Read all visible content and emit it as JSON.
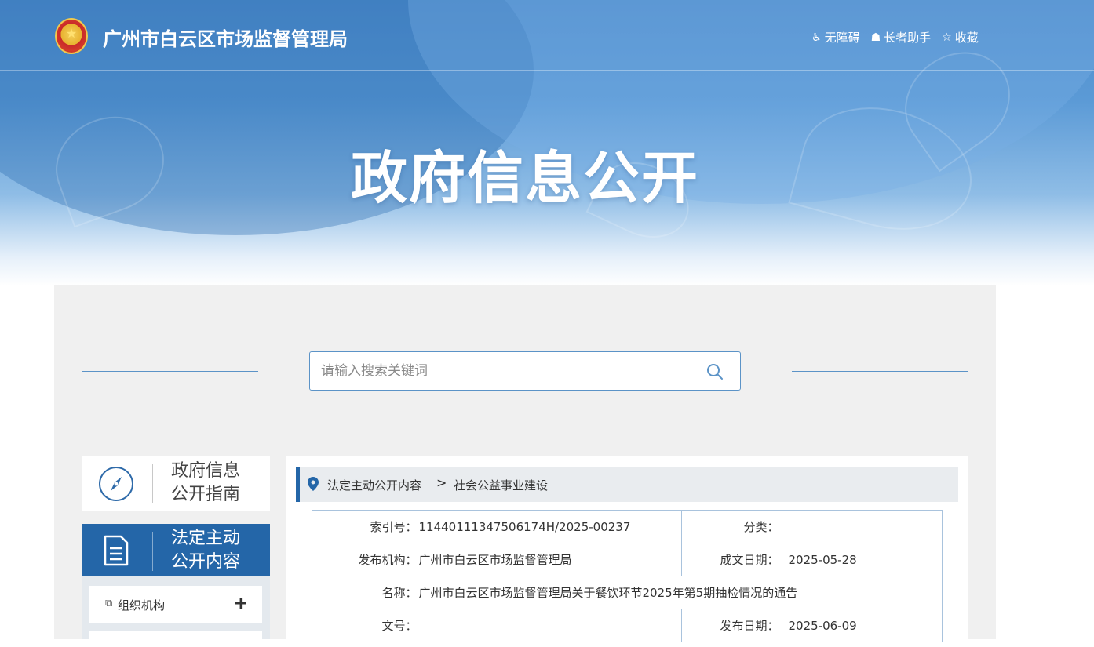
{
  "header": {
    "site_title": "广州市白云区市场监督管理局",
    "links": [
      {
        "label": "无障碍",
        "icon": "accessibility-icon"
      },
      {
        "label": "长者助手",
        "icon": "elder-assistant-icon"
      },
      {
        "label": "收藏",
        "icon": "star-icon"
      }
    ]
  },
  "hero": {
    "title": "政府信息公开"
  },
  "search": {
    "placeholder": "请输入搜索关键词"
  },
  "sidebar": {
    "guide": {
      "line1": "政府信息",
      "line2": "公开指南",
      "icon": "compass-icon"
    },
    "legal": {
      "line1": "法定主动",
      "line2": "公开内容",
      "icon": "document-icon"
    },
    "items": [
      {
        "label": "组织机构",
        "icon": "copy-icon",
        "expand": "+"
      }
    ]
  },
  "breadcrumb": {
    "level1": "法定主动公开内容",
    "separator": ">",
    "level2": "社会公益事业建设"
  },
  "meta": {
    "index_label": "索引号：",
    "index_value": "11440111347506174H/2025-00237",
    "category_label": "分类：",
    "category_value": "",
    "publisher_label": "发布机构：",
    "publisher_value": "广州市白云区市场监督管理局",
    "created_label": "成文日期：",
    "created_value": "2025-05-28",
    "name_label": "名称：",
    "name_value": "广州市白云区市场监督管理局关于餐饮环节2025年第5期抽检情况的通告",
    "docno_label": "文号：",
    "docno_value": "",
    "pubdate_label": "发布日期：",
    "pubdate_value": "2025-06-09"
  },
  "colors": {
    "primary": "#2466a8",
    "border": "#a9c3dd",
    "panel_bg": "#f0f0f0"
  }
}
